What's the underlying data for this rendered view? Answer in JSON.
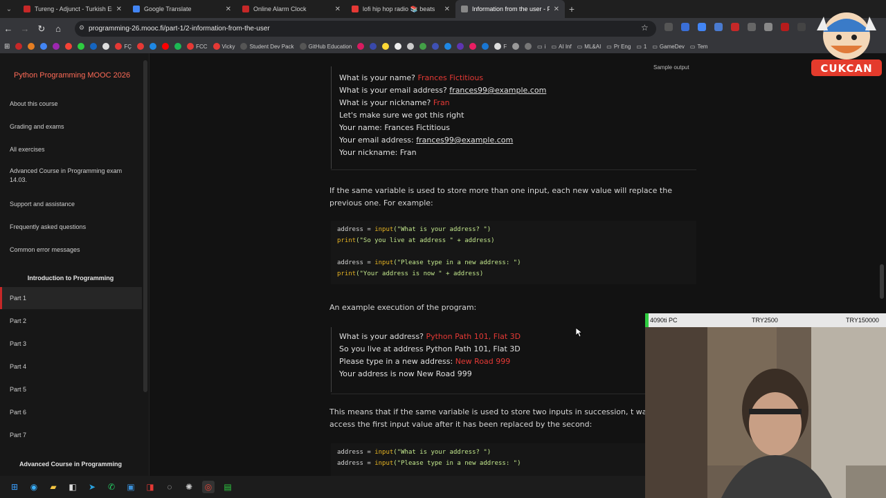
{
  "tabs": [
    {
      "title": "Tureng - Adjunct - Turkish Engl",
      "color": "#c62828"
    },
    {
      "title": "Google Translate",
      "color": "#4285f4"
    },
    {
      "title": "Online Alarm Clock",
      "color": "#c62828"
    },
    {
      "title": "lofi hip hop radio 📚 beats",
      "color": "#e53935"
    },
    {
      "title": "Information from the user - Pyt",
      "color": "#888888"
    }
  ],
  "url": "programming-26.mooc.fi/part-1/2-information-from-the-user",
  "bookmarks": [
    "FÇ",
    "FCC",
    "Vicky",
    "Student Dev Pack",
    "GitHub Education",
    "AI Inf",
    "ML&AI",
    "Pr Eng",
    "1",
    "GameDev",
    "Tem"
  ],
  "sidebar": {
    "course_title": "Python Programming MOOC 2026",
    "links": [
      "About this course",
      "Grading and exams",
      "All exercises",
      "Advanced Course in Programming exam 14.03.",
      "Support and assistance",
      "Frequently asked questions",
      "Common error messages"
    ],
    "section_intro": "Introduction to Programming",
    "parts": [
      "Part 1",
      "Part 2",
      "Part 3",
      "Part 4",
      "Part 5",
      "Part 6",
      "Part 7"
    ],
    "section_advanced": "Advanced Course in Programming"
  },
  "content": {
    "sample_label": "Sample output",
    "sample1": {
      "q_name": "What is your name? ",
      "a_name": "Frances Fictitious",
      "q_email": "What is your email address? ",
      "a_email": "frances99@example.com",
      "q_nick": "What is your nickname? ",
      "a_nick": "Fran",
      "check": "Let's make sure we got this right",
      "your_name": "Your name: Frances Fictitious",
      "your_email_label": "Your email address: ",
      "your_email": "frances99@example.com",
      "your_nick": "Your nickname: Fran"
    },
    "para1": "If the same variable is used to store more than one input, each new value will replace the previous one. For example:",
    "code1": {
      "l1a": "address = ",
      "l1b": "input",
      "l1c": "(\"What is your address? \")",
      "l2a": "print",
      "l2b": "(\"So you live at address \" + address)",
      "l3a": "address = ",
      "l3b": "input",
      "l3c": "(\"Please type in a new address: \")",
      "l4a": "print",
      "l4b": "(\"Your address is now \" + address)"
    },
    "para2": "An example execution of the program:",
    "sample2": {
      "q1": "What is your address? ",
      "a1": "Python Path 101, Flat 3D",
      "r1": "So you live at address Python Path 101, Flat 3D",
      "q2": "Please type in a new address: ",
      "a2": "New Road 999",
      "r2": "Your address is now New Road 999"
    },
    "para3": "This means that if the same variable is used to store two inputs in succession, t way to access the first input value after it has been replaced by the second:",
    "code2": {
      "l1a": "address = ",
      "l1b": "input",
      "l1c": "(\"What is your address? \")",
      "l2a": "address = ",
      "l2b": "input",
      "l2c": "(\"Please type in a new address: \")"
    }
  },
  "ticker": {
    "pc": "4090ti PC",
    "v1": "TRY2500",
    "v2": "TRY150000"
  },
  "logo_text": "CUKCAN",
  "colors": {
    "accent": "#e53935",
    "course_title": "#ff6b57",
    "active_part_bar": "#c62828"
  }
}
